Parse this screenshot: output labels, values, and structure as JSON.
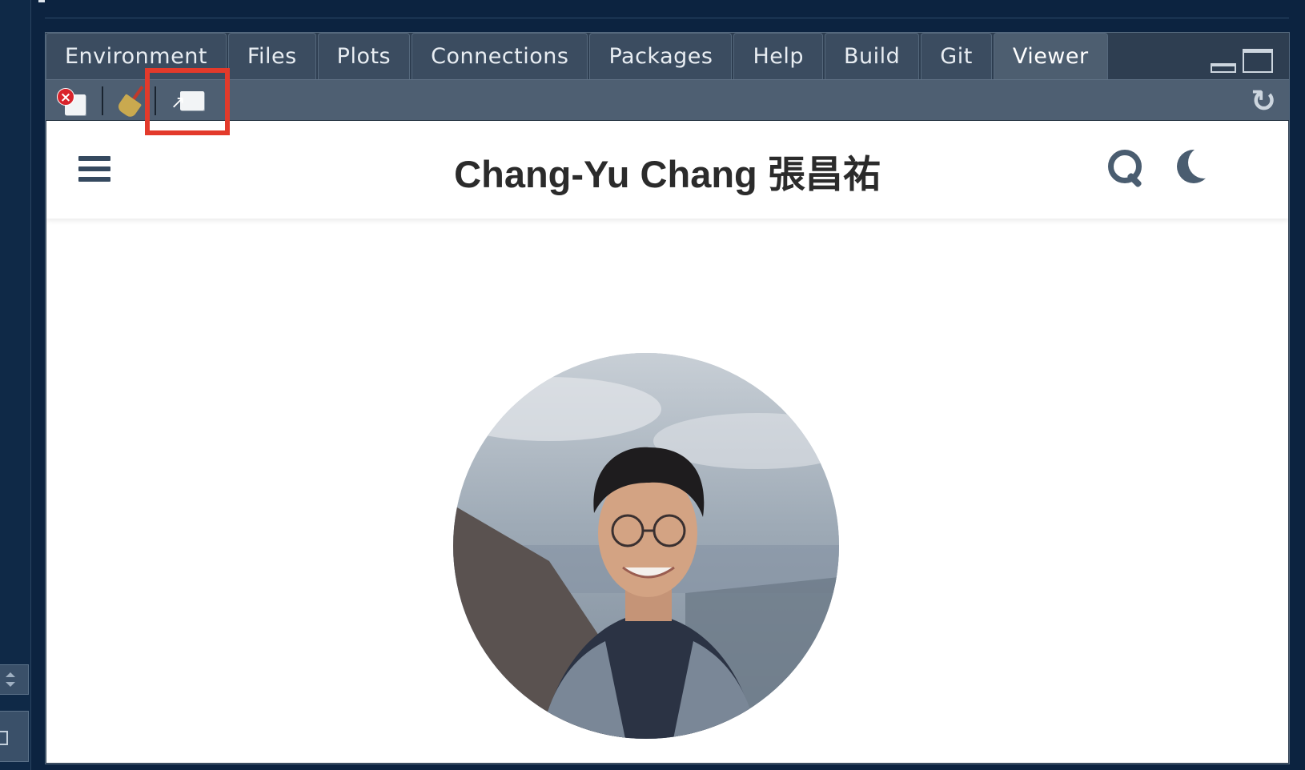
{
  "tabs": [
    {
      "label": "Environment",
      "active": false
    },
    {
      "label": "Files",
      "active": false
    },
    {
      "label": "Plots",
      "active": false
    },
    {
      "label": "Connections",
      "active": false
    },
    {
      "label": "Packages",
      "active": false
    },
    {
      "label": "Help",
      "active": false
    },
    {
      "label": "Build",
      "active": false
    },
    {
      "label": "Git",
      "active": false
    },
    {
      "label": "Viewer",
      "active": true
    }
  ],
  "toolbar": {
    "buttons": [
      "remove-viewer-icon",
      "clear-all-broom-icon",
      "export-show-in-window-icon"
    ],
    "highlighted": "export-show-in-window-icon",
    "right_button": "refresh-icon"
  },
  "viewer": {
    "site_title": "Chang-Yu Chang 張昌祐",
    "header_icons": [
      "hamburger-menu-icon",
      "search-icon",
      "dark-mode-moon-icon"
    ]
  },
  "colors": {
    "background": "#0c2340",
    "pane": "#2e3e51",
    "tab": "#3b4c60",
    "toolbar": "#4e5f72",
    "highlight": "#e33a2b",
    "title_text": "#2b2b2b",
    "icon": "#4a5d70"
  }
}
